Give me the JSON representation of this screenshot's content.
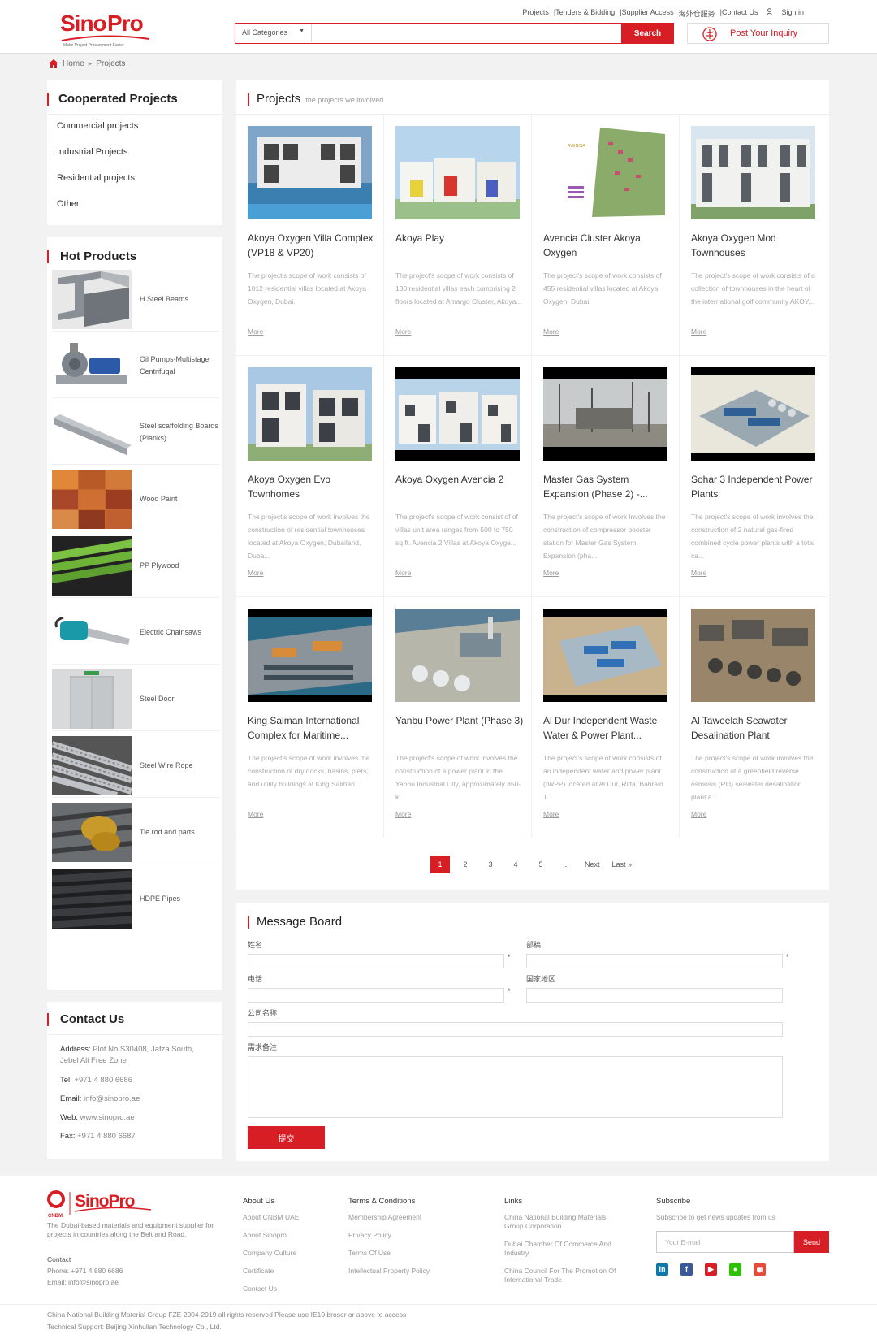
{
  "header": {
    "brand": "SinoPro",
    "tagline": "Make Project Procurement Easier",
    "nav": [
      "Projects",
      "|Tenders & Bidding",
      "|Supplier Access",
      "海外仓服务",
      "|Contact Us"
    ],
    "signin": "Sign in",
    "search": {
      "category": "All Categories",
      "value": "",
      "button": "Search"
    },
    "inquiry": "Post Your Inquiry"
  },
  "breadcrumb": {
    "home": "Home",
    "current": "Projects"
  },
  "sidebar": {
    "cooperated": {
      "title": "Cooperated Projects",
      "items": [
        "Commercial projects",
        "Industrial Projects",
        "Residential projects",
        "Other"
      ]
    },
    "hot": {
      "title": "Hot Products",
      "items": [
        "H Steel Beams",
        "Oil Pumps-Multistage Centrifugal",
        "Steel scaffolding Boards (Planks)",
        "Wood Paint",
        "PP Plywood",
        "Electric Chainsaws",
        "Steel Door",
        "Steel Wire Rope",
        "Tie rod and parts",
        "HDPE Pipes"
      ]
    },
    "contact": {
      "title": "Contact Us",
      "address_label": "Address:",
      "address": "Plot No S30408, Jafza South, Jebel Ali Free Zone",
      "tel_label": "Tel:",
      "tel": "+971 4 880 6686",
      "email_label": "Email:",
      "email": "info@sinopro.ae",
      "web_label": "Web:",
      "web": "www.sinopro.ae",
      "fax_label": "Fax:",
      "fax": "+971 4 880 6687"
    }
  },
  "projects": {
    "title": "Projects",
    "subtitle": "the projects we involved",
    "more_label": "More",
    "items": [
      {
        "title": "Akoya Oxygen Villa Complex (VP18 & VP20)",
        "desc": "The project's scope of work consists of 1012 residential villas located at Akoya Oxygen, Dubai."
      },
      {
        "title": "Akoya Play",
        "desc": "The project's scope of work consists of 130 residential villas each comprising 2 floors located at Amargo Cluster, Akoya..."
      },
      {
        "title": "Avencia Cluster Akoya Oxygen",
        "desc": "The project's scope of work consists of 455 residential villas located at Akoya Oxygen, Dubai."
      },
      {
        "title": "Akoya Oxygen Mod Townhouses",
        "desc": "The project's scope of work consists of a collection of townhouses in the heart of the international golf community AKOY..."
      },
      {
        "title": "Akoya Oxygen Evo Townhomes",
        "desc": "The project's scope of work involves the construction of residential townhouses located at Akoya Oxygen, Dubailand, Duba..."
      },
      {
        "title": "Akoya Oxygen Avencia 2",
        "desc": "The project's scope of work consist of of villas unit area ranges from 500 to 750 sq.ft. Avencia 2 Villas at Akoya Oxyge..."
      },
      {
        "title": "Master Gas System Expansion (Phase 2) -...",
        "desc": "The project's scope of work involves the construction of compressor booster station for Master Gas System Expansion (pha..."
      },
      {
        "title": "Sohar 3 Independent Power Plants",
        "desc": "The project's scope of work involves the construction of 2 natural gas-fired combined cycle power plants with a total ca..."
      },
      {
        "title": "King Salman International Complex for Maritime...",
        "desc": "The project's scope of work involves the construction of dry docks, basins, piers, and utility buildings at King Salman ..."
      },
      {
        "title": "Yanbu Power Plant (Phase 3)",
        "desc": "The project's scope of work involves the construction of a power plant in the Yanbu Industrial City, approximately 350-k..."
      },
      {
        "title": "Al Dur Independent Waste Water & Power Plant...",
        "desc": "The project's scope of work consists of an independent water and power plant (IWPP) located at Al Dur, Riffa, Bahrain. T..."
      },
      {
        "title": "Al Taweelah Seawater Desalination Plant",
        "desc": "The project's scope of work involves the construction of a greenfield reverse osmosis (RO) seawater desalination plant a..."
      }
    ],
    "pager": [
      "1",
      "2",
      "3",
      "4",
      "5",
      "...",
      "Next",
      "Last »"
    ]
  },
  "message_board": {
    "title": "Message Board",
    "name_label": "姓名",
    "dept_label": "部稿",
    "phone_label": "电话",
    "country_label": "国家地区",
    "company_label": "公司名称",
    "notes_label": "需求备注",
    "required_mark": "*",
    "submit": "提交"
  },
  "footer": {
    "brand": "SinoPro",
    "cnbm": "CNBM",
    "desc": "The Dubai-based materials and equipment supplier for projects in countries along the Belt and Road.",
    "contact_title": "Contact",
    "phone": "Phone: +971 4 880 6686",
    "email": "Email: info@sinopro.ae",
    "cols": [
      {
        "title": "About Us",
        "items": [
          "About CNBM UAE",
          "About Sinopro",
          "Company Culture",
          "Certificate",
          "Contact Us"
        ]
      },
      {
        "title": "Terms & Conditions",
        "items": [
          "Membership Agreement",
          "Privacy Policy",
          "Terms Of Use",
          "Intellectual Property Policy"
        ]
      },
      {
        "title": "Links",
        "items": [
          "China National Building Materials Group Corporation",
          "Dubai Chamber Of Commerce And Industry",
          "China Council For The Promotion Of International Trade"
        ]
      }
    ],
    "subscribe": {
      "title": "Subscribe",
      "text": "Subscribe to get news updates from us",
      "placeholder": "Your E-mail",
      "button": "Send"
    },
    "copyright": "China National Building Material Group FZE 2004-2019 all rights reserved     Please use IE10 broser or above to access",
    "support": "Technical Support: Beijing Xinhulian Technology Co., Ltd."
  },
  "colors": {
    "accent": "#d81e25"
  }
}
